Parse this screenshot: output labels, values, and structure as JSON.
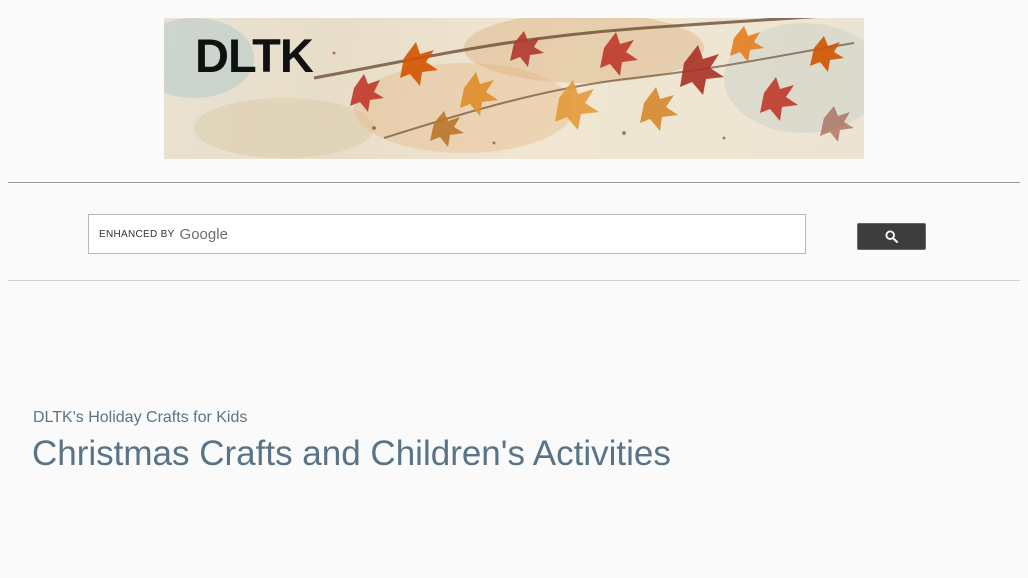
{
  "banner": {
    "logo_text": "DLTK"
  },
  "search": {
    "placeholder_prefix": "ENHANCED BY",
    "placeholder_brand": "Google",
    "value": "",
    "button_icon": "search-icon",
    "button_color": "#3d3d3d"
  },
  "heading": {
    "subtitle": "DLTK's Holiday Crafts for Kids",
    "title": "Christmas Crafts and Children's Activities",
    "color": "#597487"
  }
}
